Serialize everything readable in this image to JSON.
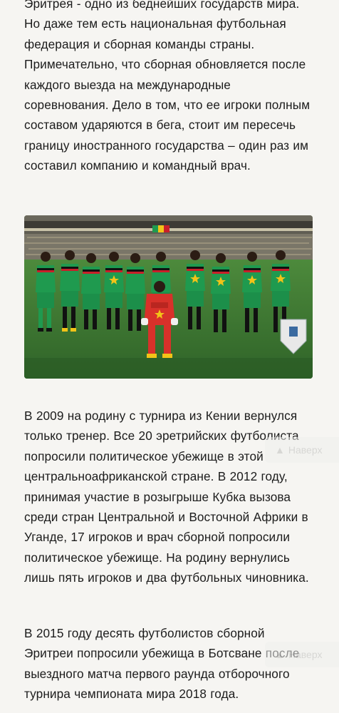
{
  "article": {
    "paragraph_1": "Эритрея - одно из беднейших государств мира. Но даже тем есть национальная футбольная федерация и сборная команды страны. Примечательно, что сборная обновляется после каждого выезда на международные соревнования. Дело в том, что ее игроки полным составом ударяются в бега, стоит им пересечь границу иностранного государства – один раз им составил компанию и командный врач.",
    "paragraph_2": "В 2009 на родину с турнира из Кении вернулся только тренер.  Все 20 эретрийских футболиста попросили политическое убежище в этой центральноафриканской стране. В 2012 году, принимая участие в розыгрыше Кубка вызова среди стран Центральной и Восточной Африки в Уганде, 17 игроков и врач сборной попросили политическое убежище. На родину вернулись лишь пять игроков и два футбольных чиновника.",
    "paragraph_3": "В 2015 году десять футболистов сборной Эритреи попросили убежища в Ботсване после выездного матча первого раунда отборочного турнира чемпионата мира 2018 года."
  },
  "scroll_to_top": {
    "label": "Наверх",
    "icon": "arrow-up-icon"
  },
  "photo": {
    "kit_colors": {
      "jersey": "#1f9a4f",
      "shorts": "#1c8f4a",
      "keeper": "#d8312a",
      "pitch": "#3f7a36",
      "flag_stripe_black": "#111111",
      "flag_stripe_red": "#c8202a",
      "star": "#f2c318"
    }
  }
}
